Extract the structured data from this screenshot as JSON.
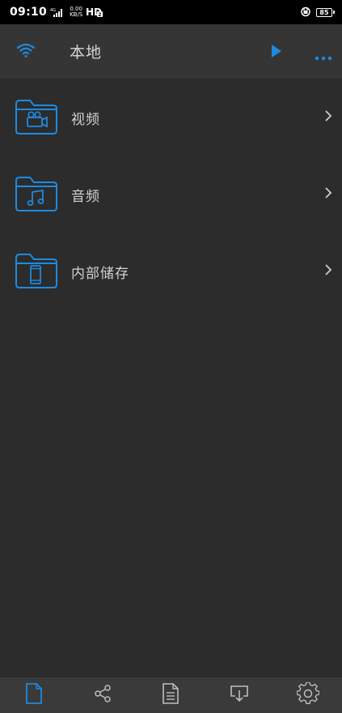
{
  "status_bar": {
    "time": "09:10",
    "network_type": "4G",
    "speed_value": "0.00",
    "speed_unit": "KB/S",
    "hd_label": "HD",
    "battery_level": "85"
  },
  "app_bar": {
    "title": "本地",
    "icons": [
      "wifi-icon",
      "play-icon",
      "more-icon"
    ]
  },
  "folders": [
    {
      "label": "视频",
      "icon": "video-camera-icon"
    },
    {
      "label": "音频",
      "icon": "music-note-icon"
    },
    {
      "label": "内部储存",
      "icon": "phone-icon"
    }
  ],
  "bottom_tabs": [
    {
      "icon": "file-icon",
      "active": true
    },
    {
      "icon": "share-icon",
      "active": false
    },
    {
      "icon": "document-list-icon",
      "active": false
    },
    {
      "icon": "download-icon",
      "active": false
    },
    {
      "icon": "settings-icon",
      "active": false
    }
  ],
  "colors": {
    "accent": "#1e8ae0",
    "background": "#2c2c2c",
    "app_bar": "#353535",
    "bottom_bar": "#3a3a3a",
    "text": "#d2d2d2"
  }
}
